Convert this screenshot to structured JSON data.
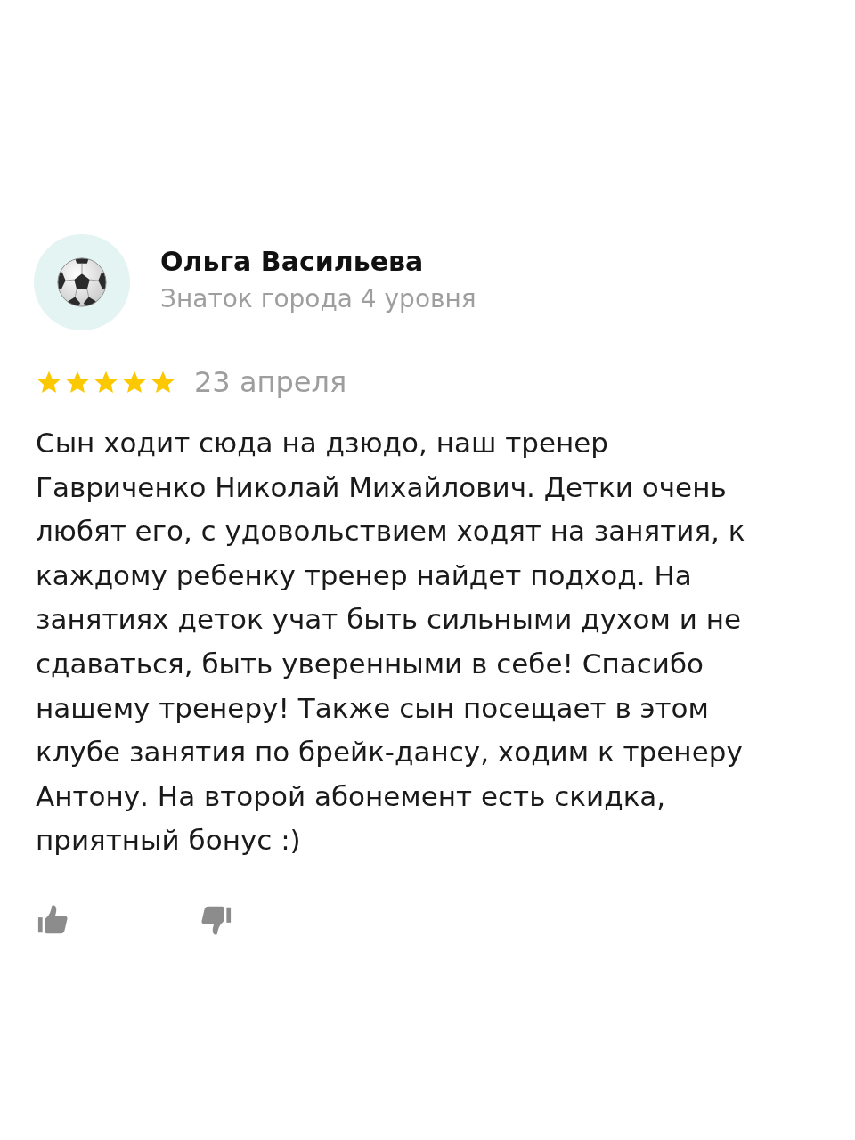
{
  "review": {
    "author": {
      "name": "Ольга Васильева",
      "status": "Знаток города 4 уровня"
    },
    "stars": 5,
    "date": "23 апреля",
    "text": "Сын ходит сюда на дзюдо, наш тренер Гавриченко Николай Михайлович. Детки очень любят его, с удовольствием ходят на занятия, к каждому ребенку тренер найдет подход. На занятиях деток учат быть сильными духом и не сдаваться, быть уверенными в себе! Спасибо нашему тренеру! Также сын посещает в этом клубе занятия по брейк-дансу, ходим к тренеру Антону. На второй абонемент есть скидка, приятный бонус :)"
  }
}
